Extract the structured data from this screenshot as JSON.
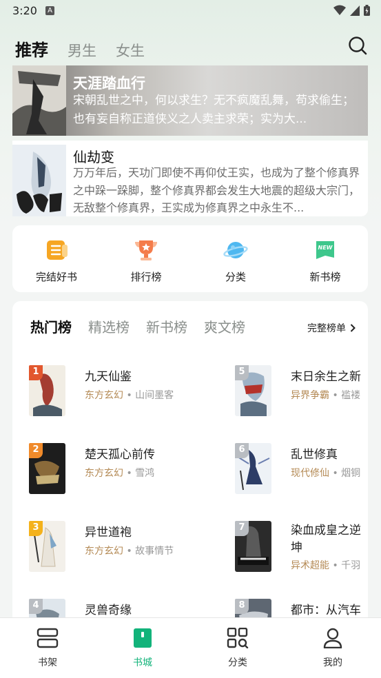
{
  "status": {
    "time": "3:20",
    "notification_icon": "A"
  },
  "top_tabs": [
    "推荐",
    "男生",
    "女生"
  ],
  "featured": {
    "title": "天涯踏血行",
    "desc": "宋朝乱世之中，何以求生？无不疯魔乱舞，苟求偷生；也有妄自称正道侠义之人卖主求荣；实为大..."
  },
  "book2": {
    "title": "仙劫变",
    "desc": "万万年后，天功门即使不再仰仗王实，也成为了整个修真界之中跺一跺脚，整个修真界都会发生大地震的超级大宗门，无敌整个修真界，王实成为修真界之中永生不..."
  },
  "quick": [
    "完结好书",
    "排行榜",
    "分类",
    "新书榜"
  ],
  "quick_icon_badge": "NEW",
  "rank_tabs": [
    "热门榜",
    "精选榜",
    "新书榜",
    "爽文榜"
  ],
  "full_list_label": "完整榜单",
  "rank_items": [
    {
      "num": "1",
      "title": "九天仙鉴",
      "genre": "东方玄幻",
      "author": "山间墨客"
    },
    {
      "num": "2",
      "title": "楚天孤心前传",
      "genre": "东方玄幻",
      "author": "雪鸿"
    },
    {
      "num": "3",
      "title": "异世道袍",
      "genre": "东方玄幻",
      "author": "故事情节"
    },
    {
      "num": "4",
      "title": "灵兽奇缘",
      "genre": "",
      "author": ""
    },
    {
      "num": "5",
      "title": "末日余生之新",
      "genre": "异界争霸",
      "author": "褴褛"
    },
    {
      "num": "6",
      "title": "乱世修真",
      "genre": "现代修仙",
      "author": "烟铜"
    },
    {
      "num": "7",
      "title": "染血成皇之逆坤",
      "genre": "异术超能",
      "author": "千羽"
    },
    {
      "num": "8",
      "title": "都市：从汽车",
      "genre": "",
      "author": ""
    }
  ],
  "bottom_nav": [
    "书架",
    "书城",
    "分类",
    "我的"
  ],
  "colors": {
    "accent": "#12b37a",
    "genre": "#b48a55",
    "rank1": "#e2572e",
    "rank2": "#f08a2a",
    "rank3": "#f4b21c",
    "rank_other": "#b9bdc2"
  }
}
